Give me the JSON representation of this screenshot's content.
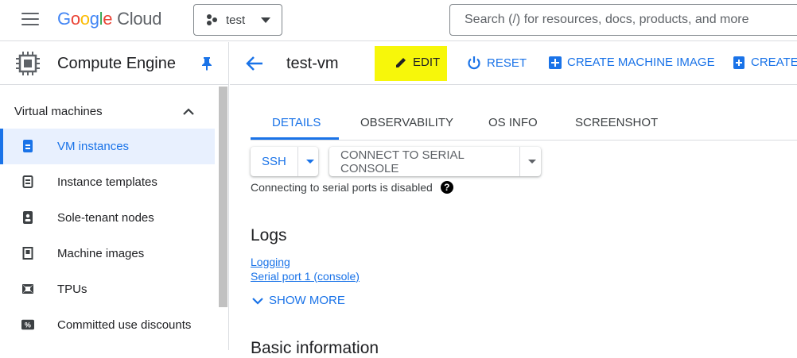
{
  "topbar": {
    "menu_icon": "hamburger-menu-icon",
    "logo": {
      "letters": [
        "G",
        "o",
        "o",
        "g",
        "l",
        "e"
      ],
      "product": "Cloud"
    },
    "project": {
      "name": "test",
      "icon": "project-dots-icon"
    },
    "search": {
      "placeholder": "Search (/) for resources, docs, products, and more"
    }
  },
  "sidebar": {
    "title": "Compute Engine",
    "section": "Virtual machines",
    "items": [
      {
        "label": "VM instances",
        "icon": "vm-instance-icon",
        "active": true
      },
      {
        "label": "Instance templates",
        "icon": "template-icon",
        "active": false
      },
      {
        "label": "Sole-tenant nodes",
        "icon": "sole-tenant-icon",
        "active": false
      },
      {
        "label": "Machine images",
        "icon": "machine-image-icon",
        "active": false
      },
      {
        "label": "TPUs",
        "icon": "tpu-icon",
        "active": false
      },
      {
        "label": "Committed use discounts",
        "icon": "discount-icon",
        "active": false
      }
    ]
  },
  "main": {
    "vm_name": "test-vm",
    "actions": {
      "edit": "EDIT",
      "reset": "RESET",
      "create_machine_image": "CREATE MACHINE IMAGE",
      "create_snapshot": "CREATE S"
    },
    "tabs": [
      "DETAILS",
      "OBSERVABILITY",
      "OS INFO",
      "SCREENSHOT"
    ],
    "active_tab": "DETAILS",
    "ssh_label": "SSH",
    "serial_label": "CONNECT TO SERIAL CONSOLE",
    "serial_note": "Connecting to serial ports is disabled",
    "help_glyph": "?",
    "logs_title": "Logs",
    "links": {
      "logging": "Logging",
      "serial_port": "Serial port 1 (console)"
    },
    "show_more": "SHOW MORE",
    "basic_info_title": "Basic information"
  },
  "colors": {
    "accent": "#1a73e8",
    "highlight": "#f7f70a",
    "active_bg": "#e8f0fe"
  }
}
